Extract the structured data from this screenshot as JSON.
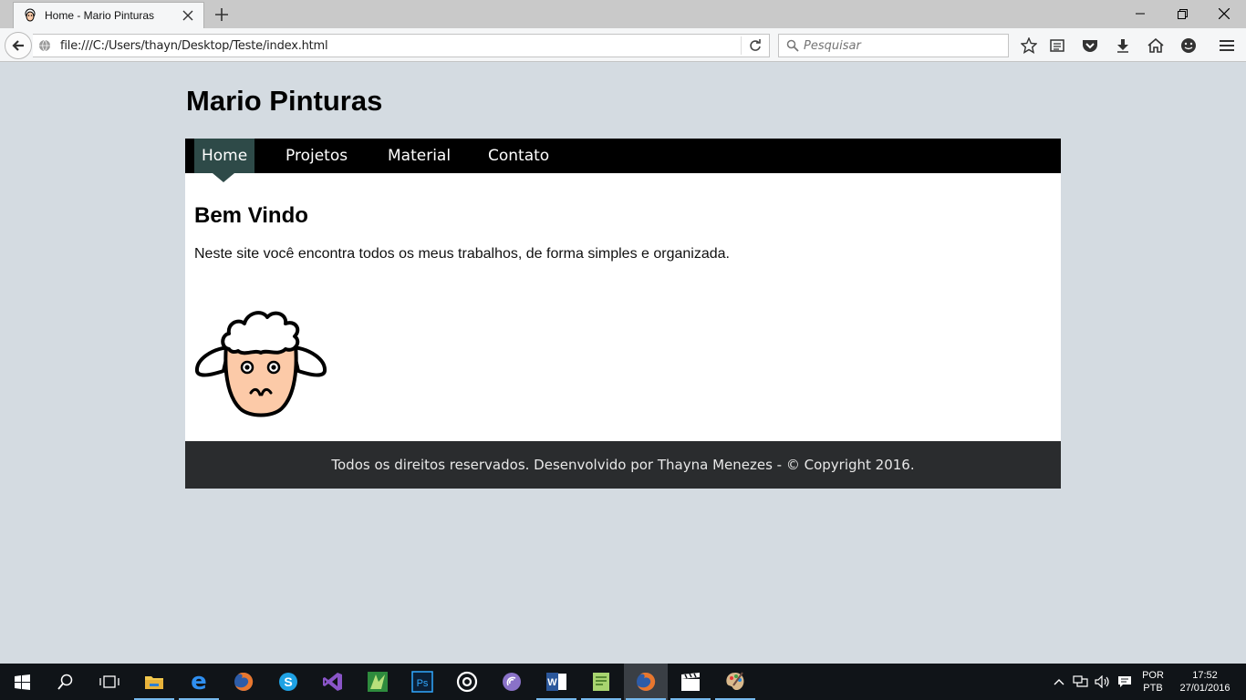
{
  "browser": {
    "tab_title": "Home - Mario Pinturas",
    "url": "file:///C:/Users/thayn/Desktop/Teste/index.html",
    "search_placeholder": "Pesquisar"
  },
  "site": {
    "title": "Mario Pinturas",
    "menu": [
      {
        "label": "Home",
        "active": true
      },
      {
        "label": "Projetos",
        "active": false
      },
      {
        "label": "Material",
        "active": false
      },
      {
        "label": "Contato",
        "active": false
      }
    ],
    "heading": "Bem Vindo",
    "intro": "Neste site você encontra todos os meus trabalhos, de forma simples e organizada.",
    "footer": "Todos os direitos reservados. Desenvolvido por Thayna Menezes - © Copyright 2016."
  },
  "taskbar": {
    "language": "POR",
    "layout": "PTB",
    "time": "17:52",
    "date": "27/01/2016",
    "apps": [
      "file-explorer-icon",
      "edge-icon",
      "firefox-icon",
      "skype-icon",
      "visual-studio-icon",
      "sketchup-icon",
      "photoshop-icon",
      "groove-icon",
      "torrent-icon",
      "word-icon",
      "notepad-icon",
      "firefox-active-icon",
      "clapper-icon",
      "paint-icon"
    ]
  },
  "colors": {
    "page_bg": "#d4dbe1",
    "menu_bg": "#000000",
    "menu_active": "#2e4a48",
    "footer_bg": "#2a2c2e"
  }
}
